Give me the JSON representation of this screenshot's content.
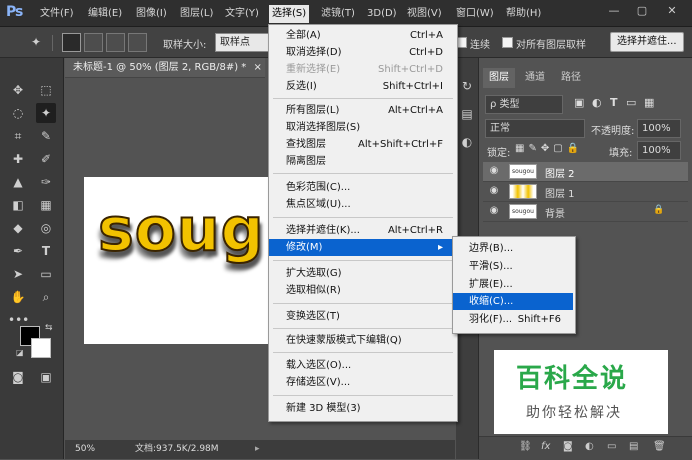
{
  "app": {
    "logo": "Ps"
  },
  "menubar": {
    "items": [
      "文件(F)",
      "编辑(E)",
      "图像(I)",
      "图层(L)",
      "文字(Y)",
      "选择(S)",
      "滤镜(T)",
      "3D(D)",
      "视图(V)",
      "窗口(W)",
      "帮助(H)"
    ],
    "window_buttons": [
      "—",
      "▢",
      "✕"
    ]
  },
  "options": {
    "size_label": "取样大小:",
    "size_value": "取样点",
    "contiguous": "连续",
    "sample_all": "对所有图层取样",
    "refine_button": "选择并遮住..."
  },
  "document": {
    "tab_title": "未标题-1 @ 50% (图层 2, RGB/8#) *",
    "close": "×",
    "canvas_text": "soug",
    "zoom": "50%",
    "doc_info": "文档:937.5K/2.98M"
  },
  "select_menu": {
    "items": [
      {
        "label": "全部(A)",
        "shortcut": "Ctrl+A"
      },
      {
        "label": "取消选择(D)",
        "shortcut": "Ctrl+D"
      },
      {
        "label": "重新选择(E)",
        "shortcut": "Shift+Ctrl+D"
      },
      {
        "label": "反选(I)",
        "shortcut": "Shift+Ctrl+I"
      },
      {
        "label": "所有图层(L)",
        "shortcut": "Alt+Ctrl+A"
      },
      {
        "label": "取消选择图层(S)",
        "shortcut": ""
      },
      {
        "label": "查找图层",
        "shortcut": "Alt+Shift+Ctrl+F"
      },
      {
        "label": "隔离图层",
        "shortcut": ""
      },
      {
        "label": "色彩范围(C)...",
        "shortcut": ""
      },
      {
        "label": "焦点区域(U)...",
        "shortcut": ""
      },
      {
        "label": "选择并遮住(K)...",
        "shortcut": "Alt+Ctrl+R"
      },
      {
        "label": "修改(M)",
        "shortcut": ""
      },
      {
        "label": "扩大选取(G)",
        "shortcut": ""
      },
      {
        "label": "选取相似(R)",
        "shortcut": ""
      },
      {
        "label": "变换选区(T)",
        "shortcut": ""
      },
      {
        "label": "在快速蒙版模式下编辑(Q)",
        "shortcut": ""
      },
      {
        "label": "载入选区(O)...",
        "shortcut": ""
      },
      {
        "label": "存储选区(V)...",
        "shortcut": ""
      },
      {
        "label": "新建 3D 模型(3)",
        "shortcut": ""
      }
    ],
    "submenu_arrow": "▸"
  },
  "modify_menu": {
    "items": [
      {
        "label": "边界(B)...",
        "shortcut": ""
      },
      {
        "label": "平滑(S)...",
        "shortcut": ""
      },
      {
        "label": "扩展(E)...",
        "shortcut": ""
      },
      {
        "label": "收缩(C)...",
        "shortcut": ""
      },
      {
        "label": "羽化(F)...",
        "shortcut": "Shift+F6"
      }
    ]
  },
  "layers_panel": {
    "tabs": [
      "图层",
      "通道",
      "路径"
    ],
    "filter_kind": "ρ 类型",
    "blend_mode": "正常",
    "opacity_label": "不透明度:",
    "opacity_value": "100%",
    "lock_label": "锁定:",
    "fill_label": "填充:",
    "fill_value": "100%",
    "layers": [
      {
        "name": "图层 2",
        "thumb": "sougou"
      },
      {
        "name": "图层 1",
        "thumb": ""
      },
      {
        "name": "背景",
        "thumb": "sougou"
      }
    ],
    "bottom_icons": [
      "link-icon",
      "fx-icon",
      "mask-icon",
      "adjustment-icon",
      "group-icon",
      "new-layer-icon",
      "trash-icon"
    ],
    "fx_label": "fx"
  },
  "watermark": {
    "title": "百科全说",
    "subtitle": "助你轻松解决"
  },
  "colors": {
    "highlight": "#0a63cf",
    "menu_bg": "#f0f0f0",
    "ui_dark": "#3a3a3a"
  }
}
